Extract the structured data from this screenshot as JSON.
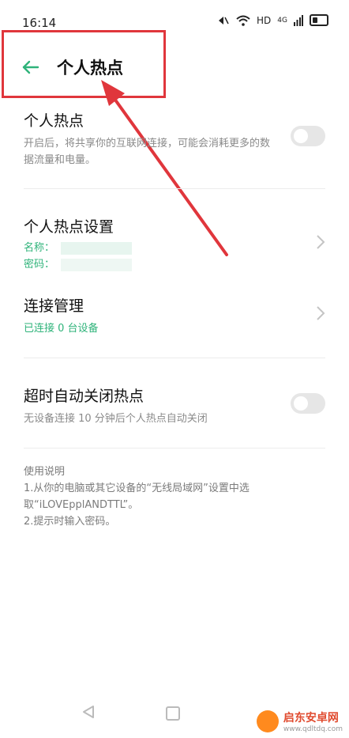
{
  "status_bar": {
    "time": "16:14",
    "hd_label": "HD",
    "network_label": "4G"
  },
  "header": {
    "title": "个人热点"
  },
  "hotspot": {
    "title": "个人热点",
    "desc": "开启后，将共享你的互联网连接，可能会消耗更多的数据流量和电量。",
    "enabled": false
  },
  "settings": {
    "title": "个人热点设置",
    "name_label": "名称：",
    "password_label": "密码："
  },
  "connections": {
    "title": "连接管理",
    "status": "已连接 0 台设备"
  },
  "auto_off": {
    "title": "超时自动关闭热点",
    "desc": "无设备连接 10 分钟后个人热点自动关闭",
    "enabled": false
  },
  "notes": {
    "heading": "使用说明",
    "line1": "1.从你的电脑或其它设备的“无线局域网”设置中选取“iLOVEpplANDTTL”。",
    "line2": "2.提示时输入密码。"
  },
  "colors": {
    "accent": "#2fb37a",
    "annotation": "#e0363c"
  },
  "watermark": {
    "name": "启东安卓网",
    "url": "www.qdltdq.com"
  }
}
